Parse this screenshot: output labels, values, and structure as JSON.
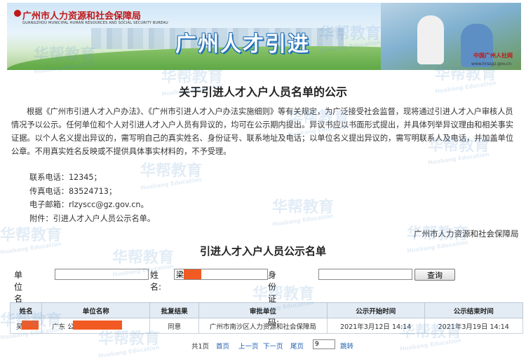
{
  "banner": {
    "bureau_cn": "广州市人力资源和社会保障局",
    "bureau_en": "GUANGZHOU MUNICIPAL HUMAN RESOURCES AND SOCIAL SECURITY BUREAU",
    "title": "广州人才引进",
    "site_logo": "中国广州人社网",
    "site_url": "www.hrssgz.gov.cn"
  },
  "notice": {
    "title": "关于引进人才入户人员名单的公示",
    "body": "根据《广州市引进人才入户办法》、《广州市引进人才入户办法实施细则》等有关规定，为广泛接受社会监督，现将通过引进人才入户审核人员情况予以公示。任何单位和个人对引进人才入户人员有异议的，均可在公示期内提出。异议书应以书面形式提出，并具体列举异议理由和相关事实证据。以个人名义提出异议的，需写明自己的真实姓名、身份证号、联系地址及电话；以单位名义提出异议的，需写明联系人及电话，并加盖单位公章。不用真实姓名反映或不提供具体事实材料的，不予受理。",
    "contacts": [
      "联系电话：12345；",
      "传真电话：83524713；",
      "电子邮箱：rlzyscc@gz.gov.cn。",
      "附件：引进人才入户人员公示名单。"
    ],
    "signature": "广州市人力资源和社会保障局"
  },
  "list": {
    "title": "引进人才入户人员公示名单",
    "search": {
      "unit_label": "单位名称:",
      "unit_value": "",
      "name_label": "姓名:",
      "name_value": "梁",
      "id_label": "身份证号码:",
      "id_value": "",
      "query_button": "查询"
    },
    "columns": [
      "姓名",
      "单位名称",
      "批复结果",
      "审批单位",
      "公示开始时间",
      "公示结束时间"
    ],
    "rows": [
      {
        "name": "吴",
        "unit": "广东                  公司",
        "result": "同意",
        "approver": "广州市南沙区人力资源和社会保障局",
        "start": "2021年3月12日 14:14",
        "end": "2021年3月19日 14:14"
      }
    ],
    "pager": {
      "total": "共1页",
      "first": "首页",
      "prev": "上一页",
      "next": "下一页",
      "last": "尾页",
      "page_value": "9",
      "go": "跳转"
    }
  },
  "watermark": {
    "cn": "华帮教育",
    "en": "Huabang Education"
  },
  "colors": {
    "redact": "#f15a22",
    "bureau_red": "#c01818",
    "title_blue": "#1f6fb8",
    "header_bg": "#e3ecf5"
  }
}
